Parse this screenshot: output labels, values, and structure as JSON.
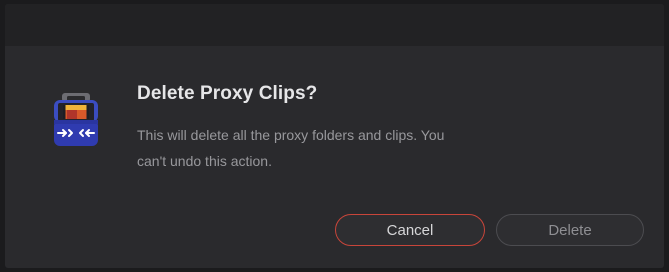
{
  "dialog": {
    "title": "Delete Proxy Clips?",
    "message": "This will delete all the proxy folders and clips. You can't undo this action.",
    "icon": "proxy-generator-app-icon"
  },
  "buttons": {
    "cancel_label": "Cancel",
    "delete_label": "Delete"
  },
  "colors": {
    "cancel_border": "#c8453a",
    "dialog_background": "#2a2a2d",
    "titlebar_background": "#222224"
  }
}
